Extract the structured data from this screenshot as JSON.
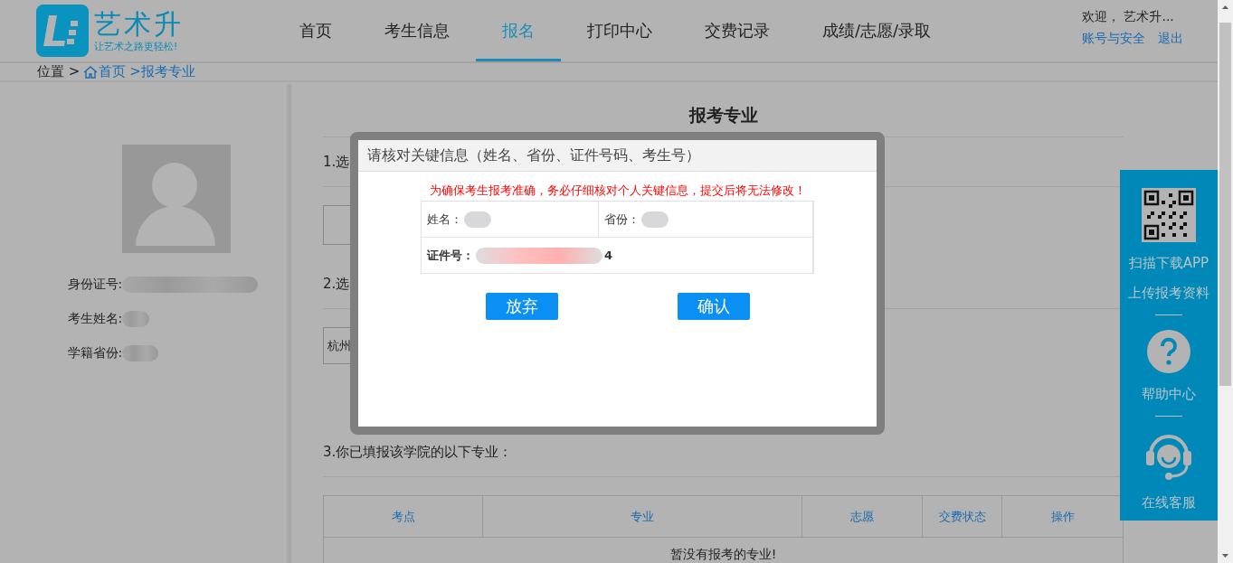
{
  "header": {
    "logo": {
      "name": "艺术升",
      "slogan": "让艺术之路更轻松!"
    },
    "nav": [
      {
        "label": "首页",
        "selected": false
      },
      {
        "label": "考生信息",
        "selected": false
      },
      {
        "label": "报名",
        "selected": true
      },
      {
        "label": "打印中心",
        "selected": false
      },
      {
        "label": "交费记录",
        "selected": false
      },
      {
        "label": "成绩/志愿/录取",
        "selected": false
      }
    ],
    "welcome": "欢迎， 艺术升...",
    "links": [
      "账号与安全",
      "退出"
    ]
  },
  "breadcrumb": {
    "label": "位置 >",
    "items": [
      {
        "text": "首页",
        "kind": "home"
      },
      {
        "text": ">报考专业",
        "kind": "plain"
      }
    ]
  },
  "profile": {
    "fields": [
      {
        "label": "身份证号:"
      },
      {
        "label": "考生姓名:"
      },
      {
        "label": "学籍省份:"
      }
    ]
  },
  "main": {
    "title": "报考专业",
    "steps": [
      "1.选",
      "2.选"
    ],
    "select_value": "杭州",
    "section3": "3.你已填报该学院的以下专业：",
    "table": {
      "columns": [
        "考点",
        "专业",
        "志愿",
        "交费状态",
        "操作"
      ],
      "empty": "暂没有报考的专业!"
    }
  },
  "modal": {
    "title": "请核对关键信息（姓名、省份、证件号码、考生号）",
    "warning": "为确保考生报考准确，务必仔细核对个人关键信息，提交后将无法修改！",
    "fields": [
      {
        "label": "姓名："
      },
      {
        "label": "省份："
      },
      {
        "label": "证件号：",
        "value_end": "4"
      }
    ],
    "buttons": [
      "放弃",
      "确认"
    ]
  },
  "side_panel": {
    "groups": [
      {
        "kind": "qr",
        "labels": [
          "扫描下载APP",
          "上传报考资料"
        ]
      },
      {
        "kind": "help",
        "labels": [
          "帮助中心"
        ]
      },
      {
        "kind": "headset",
        "labels": [
          "在线客服"
        ]
      }
    ]
  }
}
